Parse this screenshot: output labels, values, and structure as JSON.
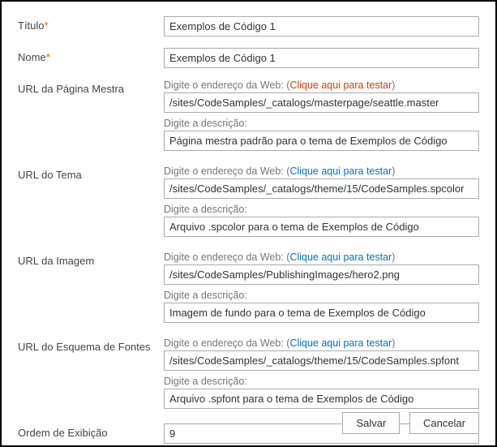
{
  "labels": {
    "title": "Título",
    "name": "Nome",
    "masterUrl": "URL da Página Mestra",
    "themeUrl": "URL do Tema",
    "imageUrl": "URL da Imagem",
    "fontSchemeUrl": "URL do Esquema de Fontes",
    "displayOrder": "Ordem de Exibição",
    "requiredMark": "*"
  },
  "hints": {
    "enterWebAddress": "Digite o endereço da Web: ",
    "paren_open": "(",
    "clickToTest": "Clique aqui para testar",
    "paren_close": ")",
    "enterDescription": "Digite a descrição:"
  },
  "values": {
    "title": "Exemplos de Código 1",
    "name": "Exemplos de Código 1",
    "masterUrl_address": "/sites/CodeSamples/_catalogs/masterpage/seattle.master",
    "masterUrl_desc": "Página mestra padrão para o tema de Exemplos de Código",
    "themeUrl_address": "/sites/CodeSamples/_catalogs/theme/15/CodeSamples.spcolor",
    "themeUrl_desc": "Arquivo .spcolor para o tema de Exemplos de Código",
    "imageUrl_address": "/sites/CodeSamples/PublishingImages/hero2.png",
    "imageUrl_desc": "Imagem de fundo para o tema de Exemplos de Código",
    "fontUrl_address": "/sites/CodeSamples/_catalogs/theme/15/CodeSamples.spfont",
    "fontUrl_desc": "Arquivo .spfont para o tema de Exemplos de Código",
    "displayOrder": "9"
  },
  "linkStates": {
    "master": "red",
    "theme": "blue",
    "image": "blue",
    "font": "blue"
  },
  "buttons": {
    "save": "Salvar",
    "cancel": "Cancelar"
  }
}
